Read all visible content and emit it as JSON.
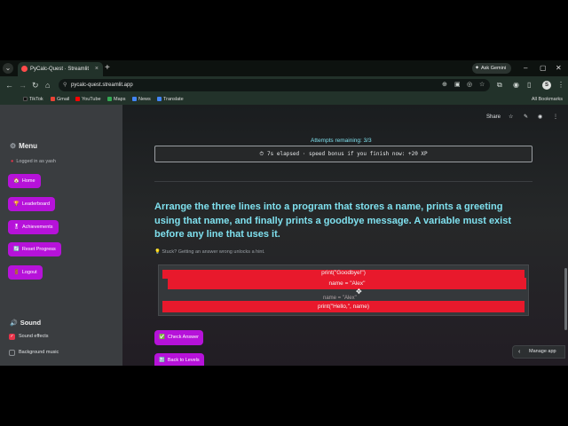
{
  "browser": {
    "tab_title": "PyCalc-Quest · Streamlit",
    "tab_close": "×",
    "new_tab": "+",
    "ask_gemini": "Ask Gemini",
    "url": "pycalc-quest.streamlit.app",
    "profile_initial": "S",
    "bookmarks": [
      "TikTok",
      "Gmail",
      "YouTube",
      "Maps",
      "News",
      "Translate"
    ],
    "all_bookmarks": "All Bookmarks"
  },
  "app": {
    "header": {
      "share_label": "Share"
    },
    "sidebar": {
      "menu_title": "Menu",
      "logged_in": "Logged in as yash",
      "nav": [
        {
          "label": "Home",
          "emoji": "🏠"
        },
        {
          "label": "Leaderboard",
          "emoji": "🏆"
        },
        {
          "label": "Achievements",
          "emoji": "🎖"
        },
        {
          "label": "Reset Progress",
          "emoji": "🔄"
        },
        {
          "label": "Logout",
          "emoji": "🚪"
        }
      ],
      "sound_title": "Sound",
      "sound_effects": "Sound effects",
      "sound_effects_checked": true,
      "background_music": "Background music",
      "background_music_checked": false
    },
    "main": {
      "attempts": "Attempts remaining: 3/3",
      "timer_text": "7s elapsed · speed bonus if you finish now: +20 XP",
      "question": "Arrange the three lines into a program that stores a name, prints a greeting using that name, and finally prints a goodbye message. A variable must exist before any line that uses it.",
      "hint": "💡 Stuck? Getting an answer wrong unlocks a hint.",
      "code_lines": [
        "print(\"Goodbye!\")",
        "name = \"Alex\"",
        "print(\"Hello,\", name)"
      ],
      "drag_ghost": "name = \"Alex\"",
      "check_button": "Check Answer",
      "back_button": "Back to Levels",
      "manage_app": "Manage app"
    }
  },
  "colors": {
    "accent_button": "#b612d9",
    "code_line": "#e8192c",
    "title_text": "#7fe0ee",
    "sidebar_bg": "#3a3d40"
  }
}
